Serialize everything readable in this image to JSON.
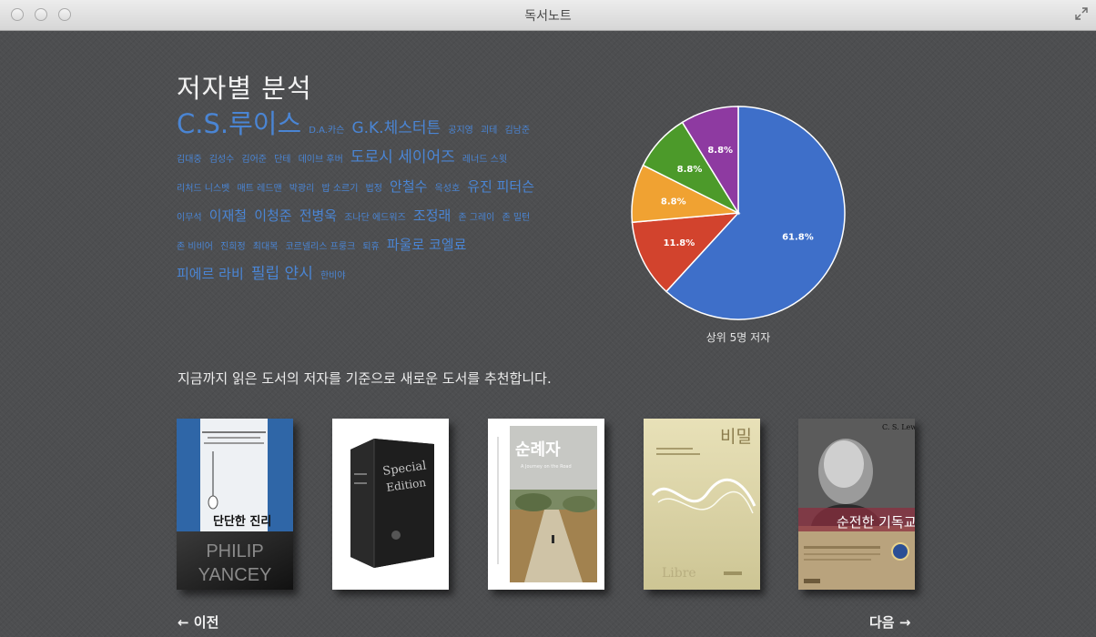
{
  "window": {
    "title": "독서노트"
  },
  "analysis": {
    "title": "저자별 분석",
    "authors": [
      {
        "name": "C.S.루이스",
        "size": "xl"
      },
      {
        "name": "D.A.카슨",
        "size": "s"
      },
      {
        "name": "G.K.체스터튼",
        "size": "l"
      },
      {
        "name": "공지영",
        "size": "s"
      },
      {
        "name": "괴테",
        "size": "s"
      },
      {
        "name": "김남준",
        "size": "s"
      },
      {
        "name": "김대중",
        "size": "s"
      },
      {
        "name": "김성수",
        "size": "s"
      },
      {
        "name": "김어준",
        "size": "s"
      },
      {
        "name": "단테",
        "size": "s"
      },
      {
        "name": "데이브 후버",
        "size": "s"
      },
      {
        "name": "도로시 세이어즈",
        "size": "l"
      },
      {
        "name": "레너드 스윗",
        "size": "s"
      },
      {
        "name": "리처드 니스벳",
        "size": "s"
      },
      {
        "name": "매트 레드맨",
        "size": "s"
      },
      {
        "name": "박광리",
        "size": "s"
      },
      {
        "name": "밥 소르기",
        "size": "s"
      },
      {
        "name": "법정",
        "size": "s"
      },
      {
        "name": "안철수",
        "size": "m"
      },
      {
        "name": "옥성호",
        "size": "s"
      },
      {
        "name": "유진 피터슨",
        "size": "m"
      },
      {
        "name": "이무석",
        "size": "s"
      },
      {
        "name": "이재철",
        "size": "m"
      },
      {
        "name": "이청준",
        "size": "m"
      },
      {
        "name": "전병욱",
        "size": "m"
      },
      {
        "name": "조나단 에드워즈",
        "size": "s"
      },
      {
        "name": "조정래",
        "size": "m"
      },
      {
        "name": "존 그레이",
        "size": "s"
      },
      {
        "name": "존 밀턴",
        "size": "s"
      },
      {
        "name": "존 비비어",
        "size": "s"
      },
      {
        "name": "진희정",
        "size": "s"
      },
      {
        "name": "최대복",
        "size": "s"
      },
      {
        "name": "코르넬리스 프룽크",
        "size": "s"
      },
      {
        "name": "퇴휴",
        "size": "s"
      },
      {
        "name": "파울로 코엘료",
        "size": "m"
      },
      {
        "name": "피에르 라비",
        "size": "m"
      },
      {
        "name": "필립 얀시",
        "size": "l"
      },
      {
        "name": "한비야",
        "size": "s"
      }
    ]
  },
  "chart_data": {
    "type": "pie",
    "title": "상위 5명 저자",
    "slices": [
      {
        "value": 61.8,
        "label": "61.8%",
        "color": "#3e6fc9"
      },
      {
        "value": 11.8,
        "label": "11.8%",
        "color": "#d2432d"
      },
      {
        "value": 8.8,
        "label": "8.8%",
        "color": "#f0a232"
      },
      {
        "value": 8.8,
        "label": "8.8%",
        "color": "#4c9a2a"
      },
      {
        "value": 8.8,
        "label": "8.8%",
        "color": "#8e3aa1"
      }
    ]
  },
  "recommendation": {
    "text": "지금까지 읽은 도서의 저자를 기준으로 새로운 도서를 추천합니다.",
    "books": [
      {
        "cover_title": "단단한 진리",
        "cover_author": "PHILIP YANCEY"
      },
      {
        "cover_title": "Special Edition"
      },
      {
        "cover_title": "순례자"
      },
      {
        "cover_title": "비밀"
      },
      {
        "cover_title": "순전한 기독교"
      }
    ]
  },
  "nav": {
    "prev": "← 이전",
    "next": "다음 →"
  },
  "colors": {
    "background": "#4d4e50",
    "accent": "#4a85d4",
    "titlebar": "#e2e2e2"
  }
}
